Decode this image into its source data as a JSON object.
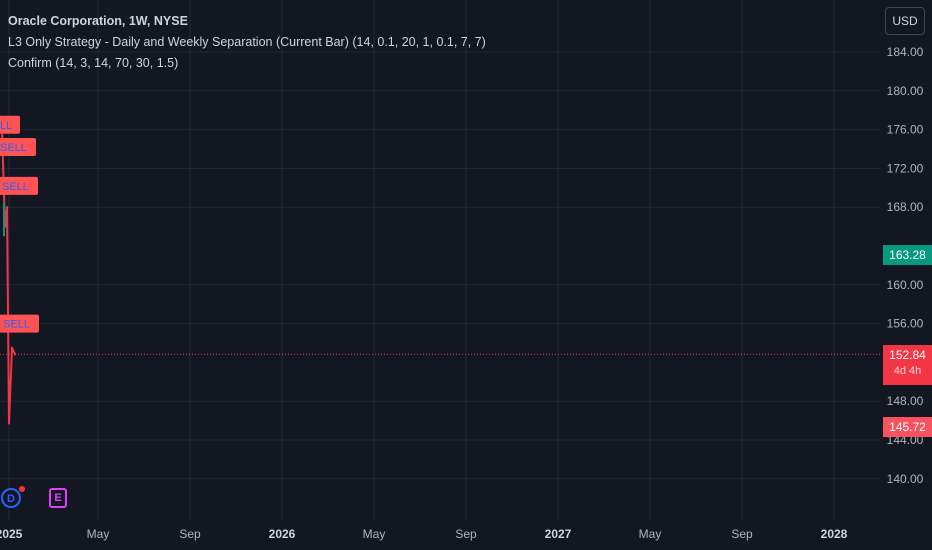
{
  "legend": {
    "title": "Oracle Corporation, 1W, NYSE",
    "strategy": "L3 Only Strategy - Daily and Weekly Separation (Current Bar) (14, 0.1, 20, 1, 0.1, 7, 7)",
    "confirm": "Confirm (14, 3, 14, 70, 30, 1.5)"
  },
  "currency_button": "USD",
  "price_tags": {
    "green": "163.28",
    "current": "152.84",
    "countdown": "4d 4h",
    "low": "145.72"
  },
  "events": {
    "dividend": "D",
    "earnings": "E"
  },
  "colors": {
    "background": "#131722",
    "grid": "#232733",
    "up": "#089981",
    "down": "#f23645",
    "signal_label": "#ff5252",
    "current_line": "#f23645"
  },
  "chart_data": {
    "type": "line",
    "y_axis": {
      "ticks": [
        "184.00",
        "180.00",
        "176.00",
        "172.00",
        "168.00",
        "160.00",
        "156.00",
        "148.00",
        "144.00",
        "140.00"
      ],
      "tick_values": [
        184,
        180,
        176,
        172,
        168,
        160,
        156,
        148,
        144,
        140
      ],
      "range": [
        138,
        186
      ]
    },
    "x_axis": {
      "ticks": [
        "2025",
        "May",
        "Sep",
        "2026",
        "May",
        "Sep",
        "2027",
        "May",
        "Sep",
        "2028"
      ],
      "bold_ticks": [
        "2025",
        "2026",
        "2027",
        "2028"
      ]
    },
    "price_series": {
      "name": "",
      "values": [
        176,
        166,
        168,
        145.72,
        153.5,
        152.84
      ]
    },
    "current_price": 152.84,
    "signal_labels": [
      {
        "text": "LL",
        "price": 176.5
      },
      {
        "text": "SELL",
        "price": 174.2
      },
      {
        "text": "SELL",
        "price": 170.2
      },
      {
        "text": "SELL",
        "price": 156
      }
    ]
  }
}
